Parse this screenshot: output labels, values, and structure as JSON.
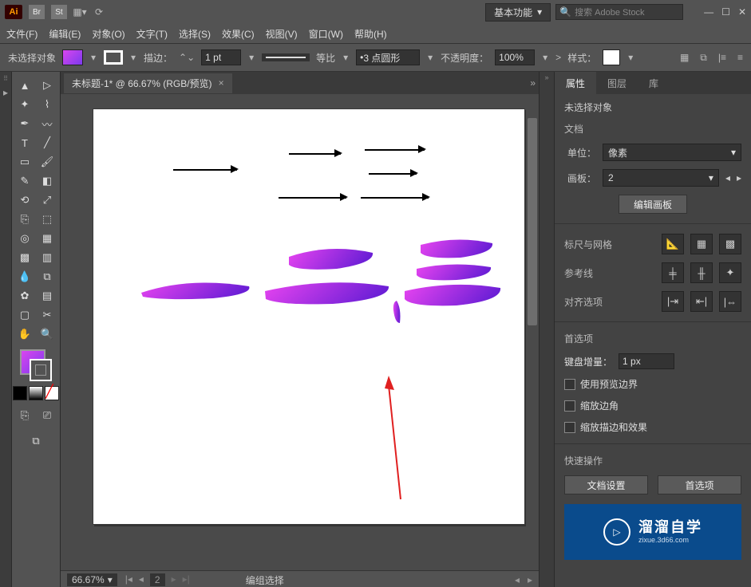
{
  "titlebar": {
    "logo": "Ai",
    "br": "Br",
    "st": "St",
    "workspace": "基本功能",
    "search_placeholder": "搜索 Adobe Stock"
  },
  "menu": {
    "file": "文件(F)",
    "edit": "编辑(E)",
    "object": "对象(O)",
    "type": "文字(T)",
    "select": "选择(S)",
    "effect": "效果(C)",
    "view": "视图(V)",
    "window": "窗口(W)",
    "help": "帮助(H)"
  },
  "options": {
    "no_selection": "未选择对象",
    "stroke_label": "描边：",
    "stroke_val": "1 pt",
    "uniform": "等比",
    "brush_val": "3 点圆形",
    "opacity_label": "不透明度：",
    "opacity_val": "100%",
    "style_label": "样式："
  },
  "doc": {
    "tab": "未标题-1* @ 66.67% (RGB/预览)",
    "zoom": "66.67%",
    "artboard_num": "2",
    "status": "编组选择"
  },
  "props": {
    "tab_props": "属性",
    "tab_layers": "图层",
    "tab_lib": "库",
    "no_selection": "未选择对象",
    "doc_label": "文档",
    "units_label": "单位：",
    "units_val": "像素",
    "artboard_label": "画板：",
    "artboard_val": "2",
    "edit_artboard": "编辑画板",
    "ruler_grid": "标尺与网格",
    "guides": "参考线",
    "align_opts": "对齐选项",
    "prefs": "首选项",
    "kb_inc": "键盘增量：",
    "kb_val": "1 px",
    "prev_bounds": "使用预览边界",
    "scale_corners": "缩放边角",
    "scale_stroke": "缩放描边和效果",
    "quick": "快速操作",
    "doc_setup": "文档设置",
    "prefs_btn": "首选项"
  },
  "logo": {
    "big": "溜溜自学",
    "small": "zixue.3d66.com"
  }
}
